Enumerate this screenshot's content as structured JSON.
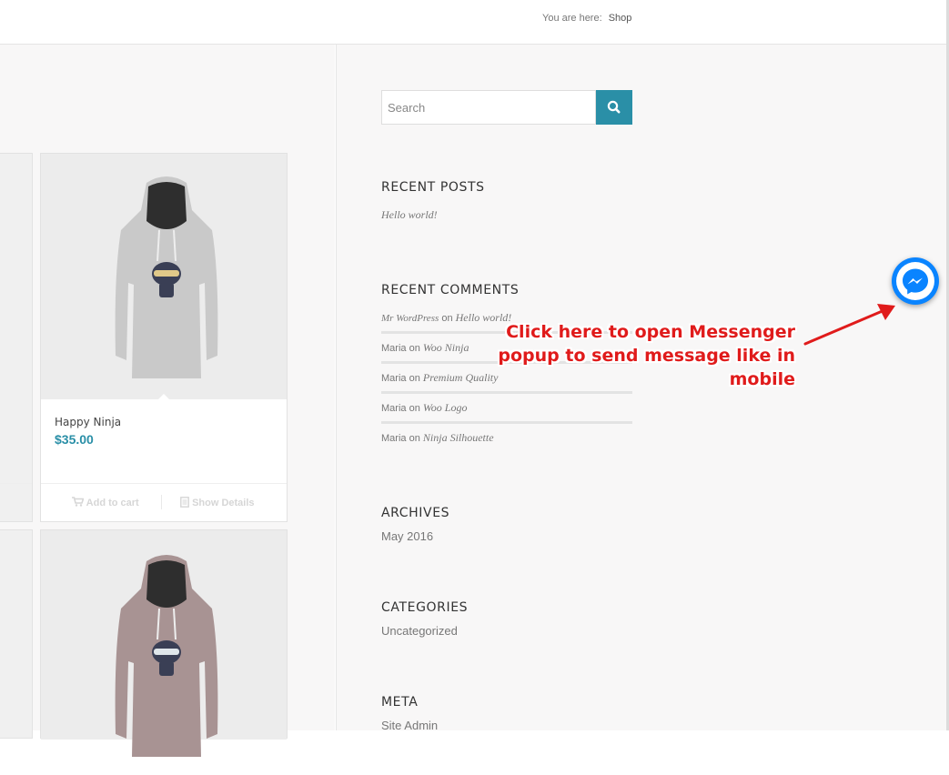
{
  "breadcrumb": {
    "prefix": "You are here:",
    "current": "Shop"
  },
  "products": [
    {
      "title": "Happy Ninja",
      "price": "$35.00",
      "add_to_cart": "Add to cart",
      "show_details": "Show Details",
      "hoodie_color": "#c9c9c9"
    },
    {
      "hoodie_color": "#a89393"
    }
  ],
  "search": {
    "placeholder": "Search"
  },
  "widgets": {
    "recent_posts": {
      "title": "RECENT POSTS",
      "items": [
        "Hello world!"
      ]
    },
    "recent_comments": {
      "title": "RECENT COMMENTS",
      "items": [
        {
          "author": "Mr WordPress",
          "on": "on",
          "post": "Hello world!"
        },
        {
          "author": "Maria",
          "on": "on",
          "post": "Woo Ninja"
        },
        {
          "author": "Maria",
          "on": "on",
          "post": "Premium Quality"
        },
        {
          "author": "Maria",
          "on": "on",
          "post": "Woo Logo"
        },
        {
          "author": "Maria",
          "on": "on",
          "post": "Ninja Silhouette"
        }
      ]
    },
    "archives": {
      "title": "ARCHIVES",
      "items": [
        "May 2016"
      ]
    },
    "categories": {
      "title": "CATEGORIES",
      "items": [
        "Uncategorized"
      ]
    },
    "meta": {
      "title": "META",
      "items": [
        "Site Admin"
      ]
    }
  },
  "messenger": {
    "icon": "messenger-icon",
    "color": "#0a84ff"
  },
  "annotation": {
    "line1": "Click here to open Messenger",
    "line2": "popup to send message like in mobile",
    "color": "#e01b1b"
  },
  "colors": {
    "accent": "#2a8fa7"
  }
}
